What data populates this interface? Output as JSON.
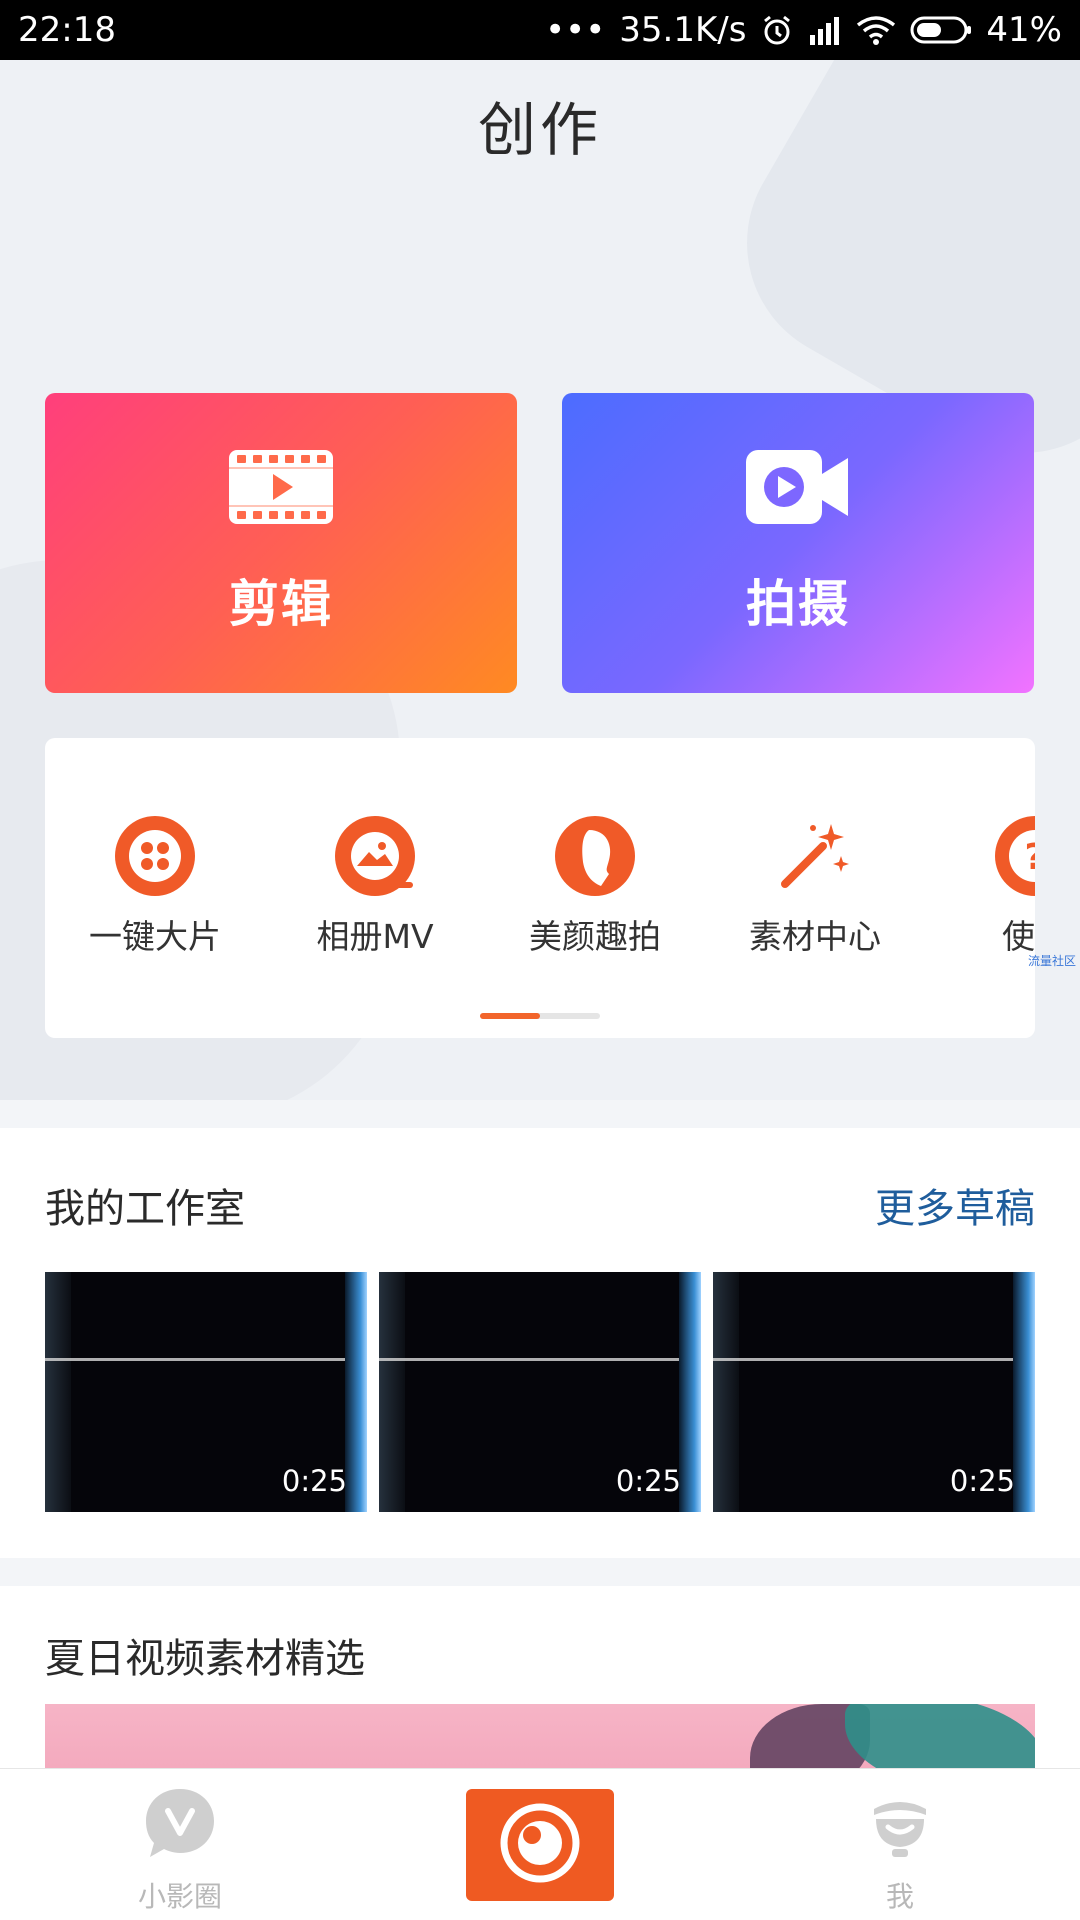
{
  "status_bar": {
    "time": "22:18",
    "dots": "•••",
    "speed": "35.1K/s",
    "battery": "41%",
    "icons": [
      "alarm-icon",
      "signal-icon",
      "wifi-icon",
      "battery-icon"
    ]
  },
  "header": {
    "title": "创作"
  },
  "cards": {
    "edit_label": "剪辑",
    "shoot_label": "拍摄",
    "edit_icon": "film-play-icon",
    "shoot_icon": "video-camera-icon"
  },
  "tools": {
    "items": [
      {
        "label": "一键大片",
        "icon": "reel-icon"
      },
      {
        "label": "相册MV",
        "icon": "album-mv-icon"
      },
      {
        "label": "美颜趣拍",
        "icon": "beauty-face-icon"
      },
      {
        "label": "素材中心",
        "icon": "magic-wand-icon"
      },
      {
        "label": "使用",
        "icon": "help-icon"
      }
    ],
    "watermark": "流量社区",
    "active_page": 1,
    "page_count": 2
  },
  "studio": {
    "title": "我的工作室",
    "more_label": "更多草稿",
    "drafts": [
      {
        "duration": "0:25"
      },
      {
        "duration": "0:25"
      },
      {
        "duration": "0:25"
      }
    ]
  },
  "summer": {
    "title": "夏日视频素材精选"
  },
  "bottom_nav": {
    "items": [
      {
        "label": "小影圈",
        "icon": "vcircle-icon"
      },
      {
        "label": "",
        "icon": "camera-lens-icon"
      },
      {
        "label": "我",
        "icon": "profile-icon"
      }
    ]
  },
  "colors": {
    "accent": "#ef5a22",
    "link": "#1f5d9c",
    "edit_gradient": [
      "#ff3f7c",
      "#ff8a22"
    ],
    "shoot_gradient": [
      "#4c6cff",
      "#f273ff"
    ]
  }
}
